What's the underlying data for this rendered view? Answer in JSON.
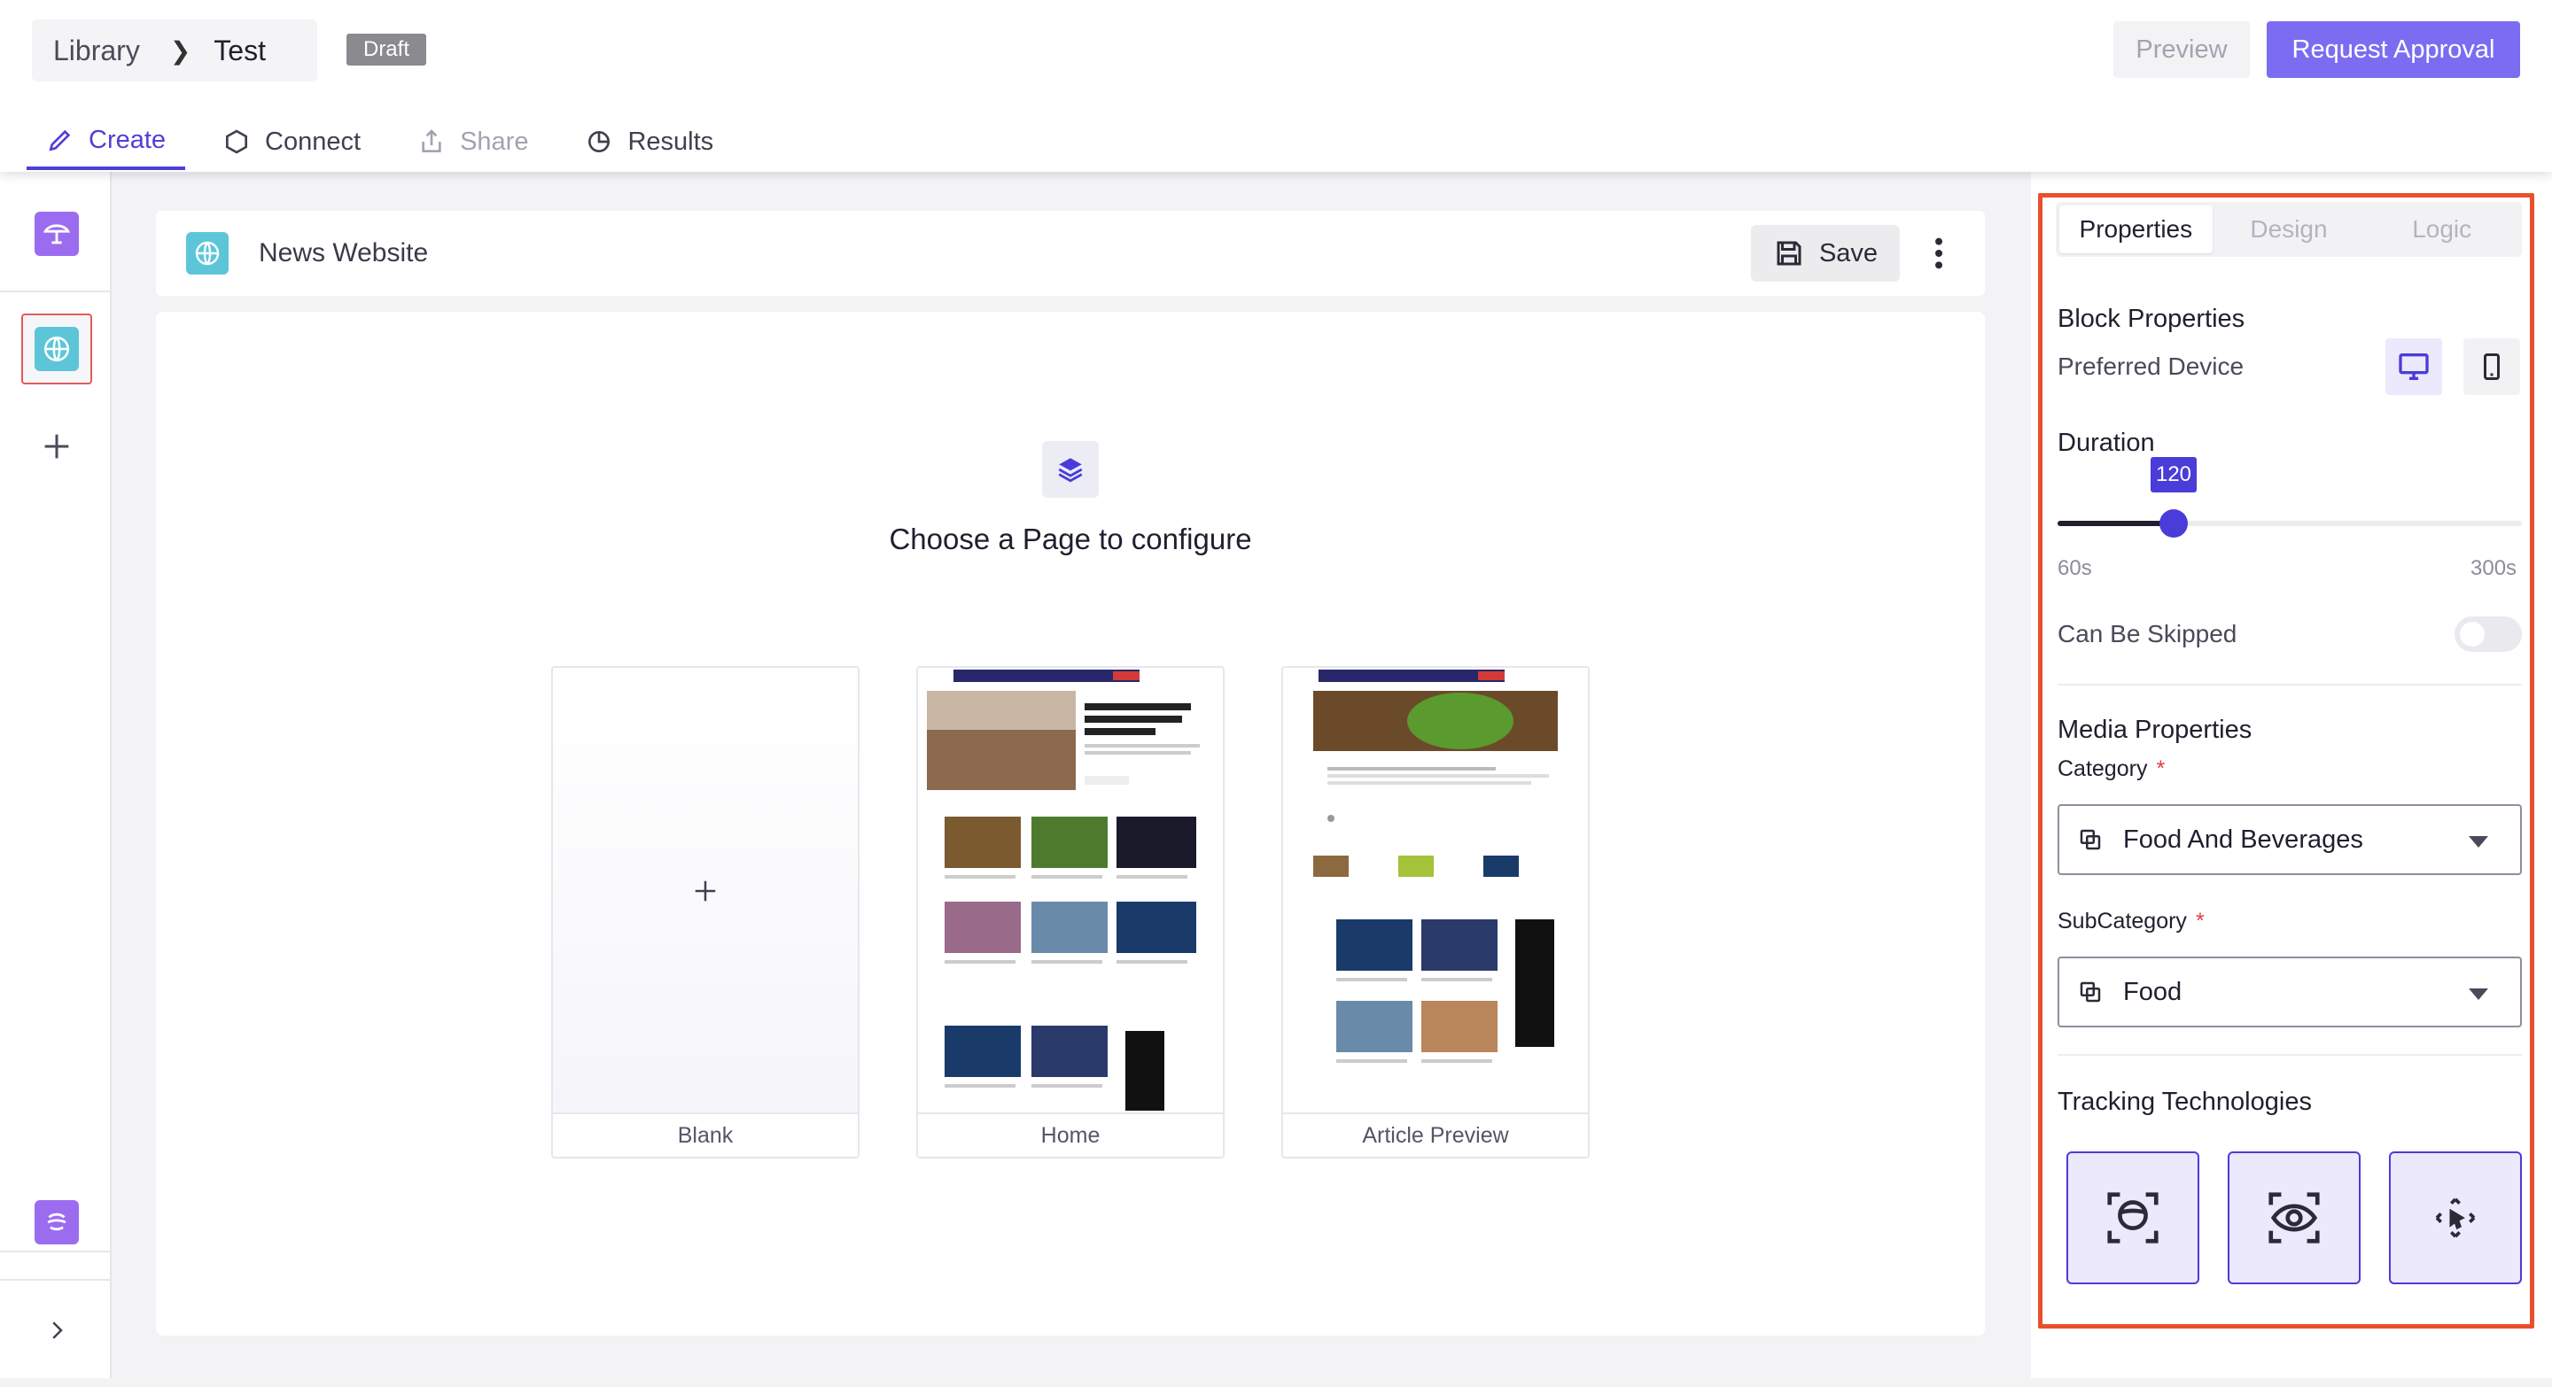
{
  "header": {
    "breadcrumb": {
      "root": "Library",
      "current": "Test"
    },
    "status_badge": "Draft",
    "preview_label": "Preview",
    "approval_label": "Request Approval",
    "tabs": [
      {
        "label": "Create",
        "icon": "pencil-icon",
        "state": "active"
      },
      {
        "label": "Connect",
        "icon": "hexagon-icon",
        "state": "normal"
      },
      {
        "label": "Share",
        "icon": "share-icon",
        "state": "disabled"
      },
      {
        "label": "Results",
        "icon": "pie-chart-icon",
        "state": "normal"
      }
    ]
  },
  "rail": {
    "items": [
      "survey-app-icon",
      "website-globe-icon",
      "add-icon",
      "brand-app-icon",
      "expand-chevron-icon"
    ]
  },
  "canvas": {
    "page_title": "News Website",
    "save_label": "Save",
    "heading": "Choose a Page to configure",
    "templates": [
      {
        "label": "Blank"
      },
      {
        "label": "Home"
      },
      {
        "label": "Article Preview"
      }
    ]
  },
  "panel": {
    "tabs": [
      {
        "label": "Properties",
        "active": true
      },
      {
        "label": "Design",
        "active": false
      },
      {
        "label": "Logic",
        "active": false
      }
    ],
    "block_properties": {
      "title": "Block Properties",
      "preferred_device_label": "Preferred Device",
      "selected_device": "desktop"
    },
    "duration": {
      "title": "Duration",
      "value": 120,
      "value_label": "120",
      "min": 60,
      "max": 300,
      "min_label": "60s",
      "max_label": "300s"
    },
    "can_be_skipped": {
      "label": "Can Be Skipped",
      "enabled": false
    },
    "media_properties": {
      "title": "Media Properties",
      "category_label": "Category",
      "category_value": "Food And Beverages",
      "subcategory_label": "SubCategory",
      "subcategory_value": "Food",
      "required_mark": "*"
    },
    "tracking": {
      "title": "Tracking Technologies",
      "options": [
        "face-tracking-icon",
        "eye-tracking-icon",
        "cursor-tracking-icon"
      ]
    }
  },
  "colors": {
    "accent": "#4f3fd8",
    "approval_button": "#7b6cf2",
    "highlight_outline": "#e8502c"
  }
}
